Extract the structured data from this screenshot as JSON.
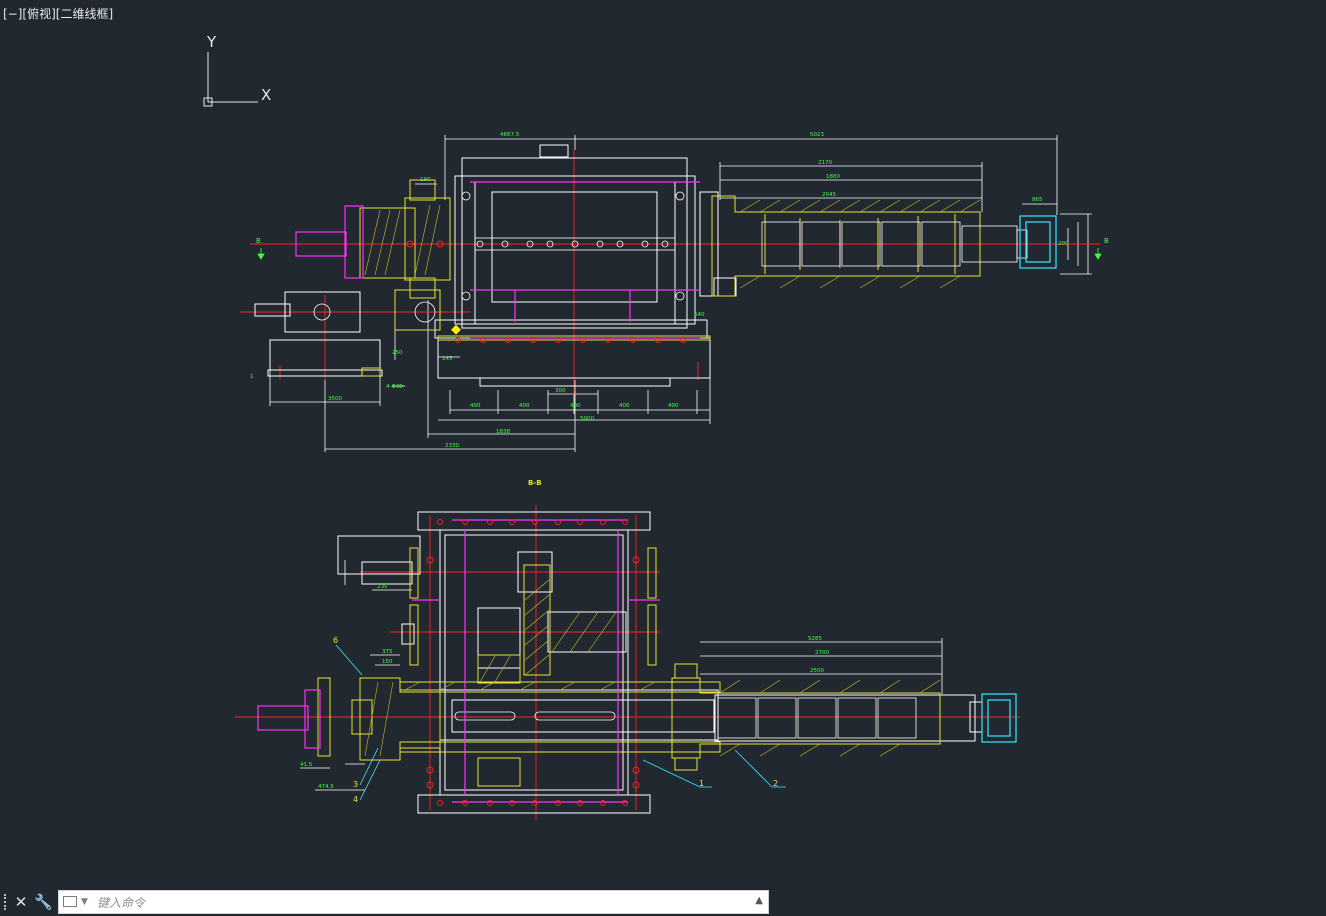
{
  "viewport": {
    "label": "[−][俯视][二维线框]",
    "ucs": {
      "x_label": "X",
      "y_label": "Y"
    }
  },
  "drawing": {
    "section_label": "B-B",
    "top_dims": [
      "4667.5",
      "5023",
      "2170",
      "1880",
      "2045",
      "865",
      "190",
      "200",
      "640",
      "400",
      "400",
      "300",
      "400",
      "400",
      "400",
      "5000",
      "1838",
      "2330",
      "3500",
      "4-Φ30",
      "250",
      "145",
      "1"
    ],
    "bottom_dims": [
      "5285",
      "2700",
      "2500",
      "375",
      "150",
      "41.5",
      "474.5",
      "235"
    ],
    "part_numbers": [
      "6",
      "3",
      "4",
      "1",
      "2"
    ],
    "section_markers": [
      "B",
      "B"
    ]
  },
  "command": {
    "placeholder": "键入命令"
  },
  "colors": {
    "background": "#212830",
    "white": "#ffffff",
    "yellow": "#e8e230",
    "red": "#ff2020",
    "magenta": "#ff30ff",
    "cyan": "#30e8ff",
    "green": "#30ff30",
    "blue_gray": "#8aa0c8"
  }
}
